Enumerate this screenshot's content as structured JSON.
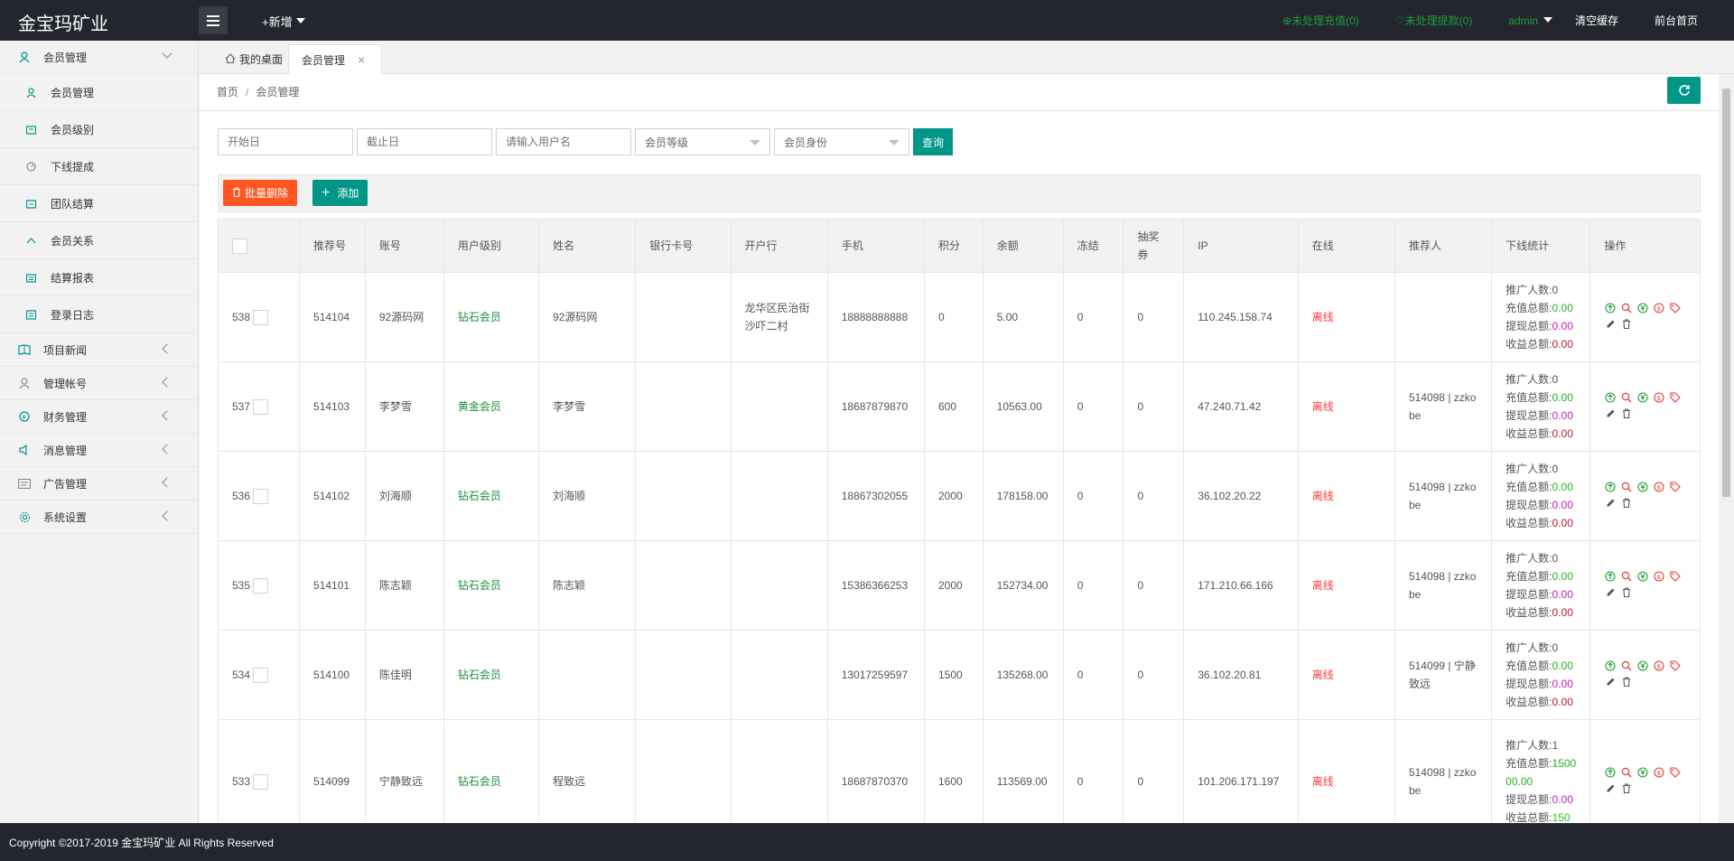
{
  "header": {
    "logo": "金宝玛矿业",
    "new_label": "+新增",
    "pending_recharge": "未处理充值(0)",
    "pending_withdraw": "未处理提款(0)",
    "admin": "admin",
    "clear_cache": "清空缓存",
    "frontend": "前台首页"
  },
  "sidebar": {
    "groups": [
      {
        "label": "会员管理",
        "icon": "user-icon",
        "expanded": true
      },
      {
        "label": "项目新闻",
        "icon": "news-icon"
      },
      {
        "label": "管理帐号",
        "icon": "account-icon"
      },
      {
        "label": "财务管理",
        "icon": "finance-icon"
      },
      {
        "label": "消息管理",
        "icon": "message-icon"
      },
      {
        "label": "广告管理",
        "icon": "ad-icon"
      },
      {
        "label": "系统设置",
        "icon": "settings-icon"
      }
    ],
    "sub_items": [
      {
        "label": "会员管理",
        "icon": "user-icon"
      },
      {
        "label": "会员级别",
        "icon": "level-icon"
      },
      {
        "label": "下线提成",
        "icon": "commission-icon"
      },
      {
        "label": "团队结算",
        "icon": "team-icon"
      },
      {
        "label": "会员关系",
        "icon": "relation-icon"
      },
      {
        "label": "结算报表",
        "icon": "report-icon"
      },
      {
        "label": "登录日志",
        "icon": "log-icon"
      }
    ]
  },
  "tabs": [
    {
      "label": "我的桌面",
      "icon": "home-icon"
    },
    {
      "label": "会员管理",
      "active": true
    }
  ],
  "breadcrumb": [
    "首页",
    "会员管理"
  ],
  "filters": {
    "start_placeholder": "开始日",
    "end_placeholder": "截止日",
    "username_placeholder": "请输入用户名",
    "level_select": "会员等级",
    "identity_select": "会员身份",
    "query_label": "查询"
  },
  "toolbar": {
    "batch_delete": "批量删除",
    "add": "添加"
  },
  "table": {
    "columns": [
      "",
      "推荐号",
      "账号",
      "用户级别",
      "姓名",
      "银行卡号",
      "开户行",
      "手机",
      "积分",
      "余额",
      "冻结",
      "抽奖券",
      "IP",
      "在线",
      "推荐人",
      "下线统计",
      "操作"
    ],
    "stat_labels": {
      "promo": "推广人数:",
      "recharge": "充值总额:",
      "withdraw": "提现总额:",
      "income": "收益总额:"
    },
    "rows": [
      {
        "id": "538",
        "ref_no": "514104",
        "account": "92源码网",
        "level": "钻石会员",
        "name": "92源码网",
        "bank_card": "",
        "bank": "龙华区民治街沙吓二村",
        "phone": "18888888888",
        "points": "0",
        "balance": "5.00",
        "frozen": "0",
        "lottery": "0",
        "ip": "110.245.158.74",
        "online": "离线",
        "referrer": "",
        "promo": "0",
        "recharge": "0.00",
        "withdraw": "0.00",
        "income": "0.00"
      },
      {
        "id": "537",
        "ref_no": "514103",
        "account": "李梦雪",
        "level": "黄金会员",
        "name": "李梦雪",
        "bank_card": "",
        "bank": "",
        "phone": "18687879870",
        "points": "600",
        "balance": "10563.00",
        "frozen": "0",
        "lottery": "0",
        "ip": "47.240.71.42",
        "online": "离线",
        "referrer": "514098 | zzkobe",
        "promo": "0",
        "recharge": "0.00",
        "withdraw": "0.00",
        "income": "0.00"
      },
      {
        "id": "536",
        "ref_no": "514102",
        "account": "刘海顺",
        "level": "钻石会员",
        "name": "刘海顺",
        "bank_card": "",
        "bank": "",
        "phone": "18867302055",
        "points": "2000",
        "balance": "178158.00",
        "frozen": "0",
        "lottery": "0",
        "ip": "36.102.20.22",
        "online": "离线",
        "referrer": "514098 | zzkobe",
        "promo": "0",
        "recharge": "0.00",
        "withdraw": "0.00",
        "income": "0.00"
      },
      {
        "id": "535",
        "ref_no": "514101",
        "account": "陈志颖",
        "level": "钻石会员",
        "name": "陈志颖",
        "bank_card": "",
        "bank": "",
        "phone": "15386366253",
        "points": "2000",
        "balance": "152734.00",
        "frozen": "0",
        "lottery": "0",
        "ip": "171.210.66.166",
        "online": "离线",
        "referrer": "514098 | zzkobe",
        "promo": "0",
        "recharge": "0.00",
        "withdraw": "0.00",
        "income": "0.00"
      },
      {
        "id": "534",
        "ref_no": "514100",
        "account": "陈佳明",
        "level": "钻石会员",
        "name": "",
        "bank_card": "",
        "bank": "",
        "phone": "13017259597",
        "points": "1500",
        "balance": "135268.00",
        "frozen": "0",
        "lottery": "0",
        "ip": "36.102.20.81",
        "online": "离线",
        "referrer": "514099 | 宁静致远",
        "promo": "0",
        "recharge": "0.00",
        "withdraw": "0.00",
        "income": "0.00"
      },
      {
        "id": "533",
        "ref_no": "514099",
        "account": "宁静致远",
        "level": "钻石会员",
        "name": "程致远",
        "bank_card": "",
        "bank": "",
        "phone": "18687870370",
        "points": "1600",
        "balance": "113569.00",
        "frozen": "0",
        "lottery": "0",
        "ip": "101.206.171.197",
        "online": "离线",
        "referrer": "514098 | zzkobe",
        "promo": "1",
        "recharge": "150000.00",
        "withdraw": "0.00",
        "income": "150"
      }
    ]
  },
  "footer": "Copyright ©2017-2019 金宝玛矿业 All Rights Reserved",
  "colors": {
    "primary": "#009688",
    "danger": "#ff5722",
    "topbar": "#23262e",
    "level": "#1e8e3e",
    "offline": "#ff3b3b"
  }
}
